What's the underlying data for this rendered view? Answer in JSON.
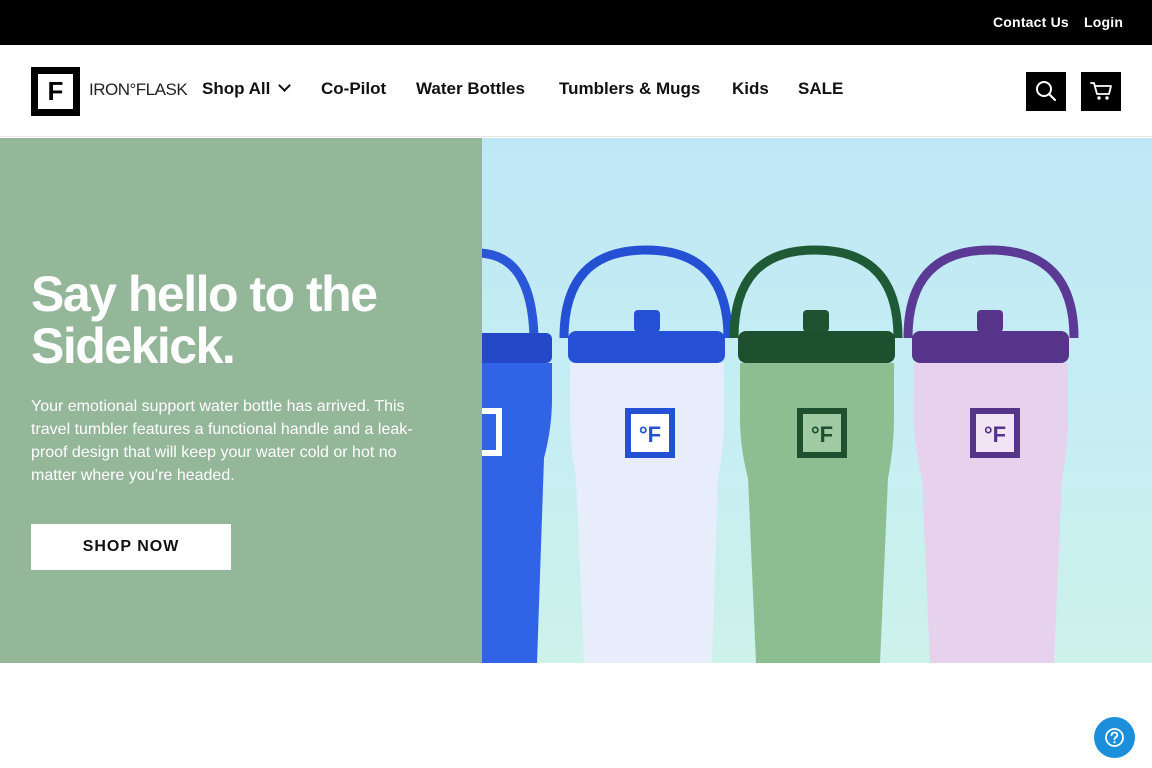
{
  "topbar": {
    "contact_label": "Contact Us",
    "login_label": "Login"
  },
  "header": {
    "logo": {
      "mark_letter": "F",
      "wordmark": "IRON°FLASK"
    },
    "nav": {
      "shop_all": "Shop All",
      "copilot": "Co-Pilot",
      "water_bottles": "Water Bottles",
      "tumblers_mugs": "Tumblers & Mugs",
      "kids": "Kids",
      "sale": "SALE"
    },
    "icons": {
      "search": "search-icon",
      "cart": "cart-icon"
    }
  },
  "hero": {
    "title": "Say hello to the Sidekick.",
    "description": "Your emotional support water bottle has arrived. This travel tumbler features a functional handle and a leak-proof design that will keep your water cold or hot no matter where you’re headed.",
    "cta_label": "SHOP NOW",
    "bottle_logo_text": "°F",
    "colors": {
      "left_panel": "#94b699",
      "tumbler_blue": "#2f5fe0",
      "tumbler_white": "#e6edfa",
      "tumbler_green": "#8fbf94",
      "tumbler_lilac": "#e7d1ec"
    }
  },
  "help": {
    "icon": "help-icon"
  }
}
